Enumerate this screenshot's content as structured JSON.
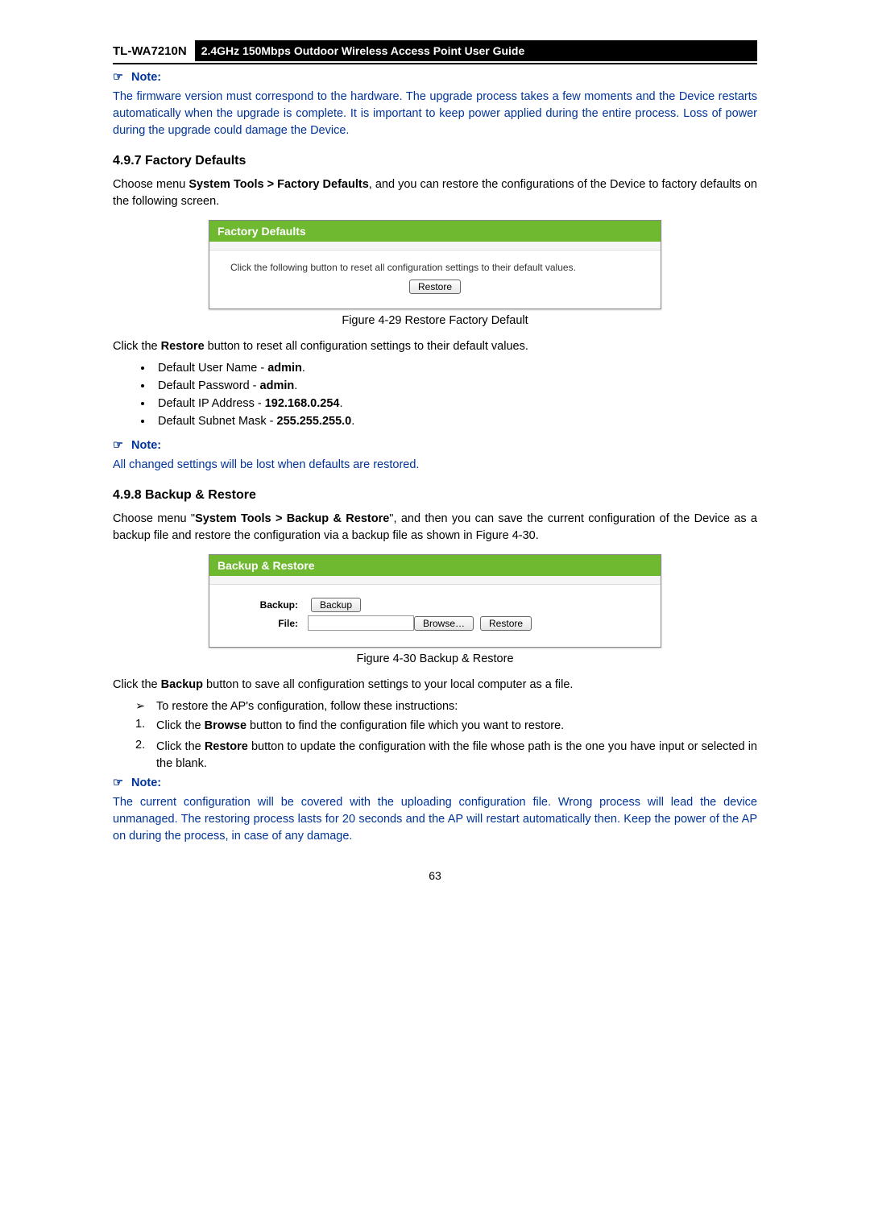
{
  "header": {
    "model": "TL-WA7210N",
    "guide": "2.4GHz 150Mbps Outdoor Wireless Access Point User Guide"
  },
  "note1": {
    "label": "Note:",
    "text": "The firmware version must correspond to the hardware. The upgrade process takes a few moments and the Device restarts automatically when the upgrade is complete. It is important to keep power applied during the entire process. Loss of power during the upgrade could damage the Device."
  },
  "section1": {
    "title": "4.9.7  Factory Defaults",
    "intro_prefix": "Choose menu ",
    "intro_bold": "System Tools > Factory Defaults",
    "intro_suffix": ", and you can restore the configurations of the Device to factory defaults on the following screen.",
    "panel_title": "Factory Defaults",
    "panel_instruction": "Click the following button to reset all configuration settings to their default values.",
    "restore_button": "Restore",
    "caption": "Figure 4-29 Restore Factory Default",
    "click_prefix": "Click the ",
    "click_bold": "Restore",
    "click_suffix": " button to reset all configuration settings to their default values.",
    "defaults": [
      {
        "label": "Default User Name - ",
        "value": "admin",
        "suffix": "."
      },
      {
        "label": "Default Password - ",
        "value": "admin",
        "suffix": "."
      },
      {
        "label": "Default IP Address - ",
        "value": "192.168.0.254",
        "suffix": "."
      },
      {
        "label": "Default Subnet Mask - ",
        "value": "255.255.255.0",
        "suffix": "."
      }
    ]
  },
  "note2": {
    "label": "Note:",
    "text": "All changed settings will be lost when defaults are restored."
  },
  "section2": {
    "title": "4.9.8  Backup & Restore",
    "intro_p1": "Choose menu \"",
    "intro_bold": "System Tools > Backup & Restore",
    "intro_p2": "\", and then you can save the current configuration of the Device as a backup file and restore the configuration via a backup file as shown in Figure 4-30.",
    "panel_title": "Backup & Restore",
    "backup_label": "Backup:",
    "backup_button": "Backup",
    "file_label": "File:",
    "browse_button": "Browse…",
    "restore_button": "Restore",
    "caption": "Figure 4-30 Backup & Restore",
    "click_prefix": "Click the ",
    "click_bold": "Backup",
    "click_suffix": " button to save all configuration settings to your local computer as a file.",
    "arrow_item": "To restore the AP's configuration, follow these instructions:",
    "step1_prefix": "Click the ",
    "step1_bold": "Browse",
    "step1_suffix": " button to find the configuration file which you want to restore.",
    "step2_prefix": "Click the ",
    "step2_bold": "Restore",
    "step2_suffix": " button to update the configuration with the file whose path is the one you have input or selected in the blank."
  },
  "note3": {
    "label": "Note:",
    "text": "The current configuration will be covered with the uploading configuration file. Wrong process will lead the device unmanaged. The restoring process lasts for 20 seconds and the AP will restart automatically then. Keep the power of the AP on during the process, in case of any damage."
  },
  "page_number": "63"
}
